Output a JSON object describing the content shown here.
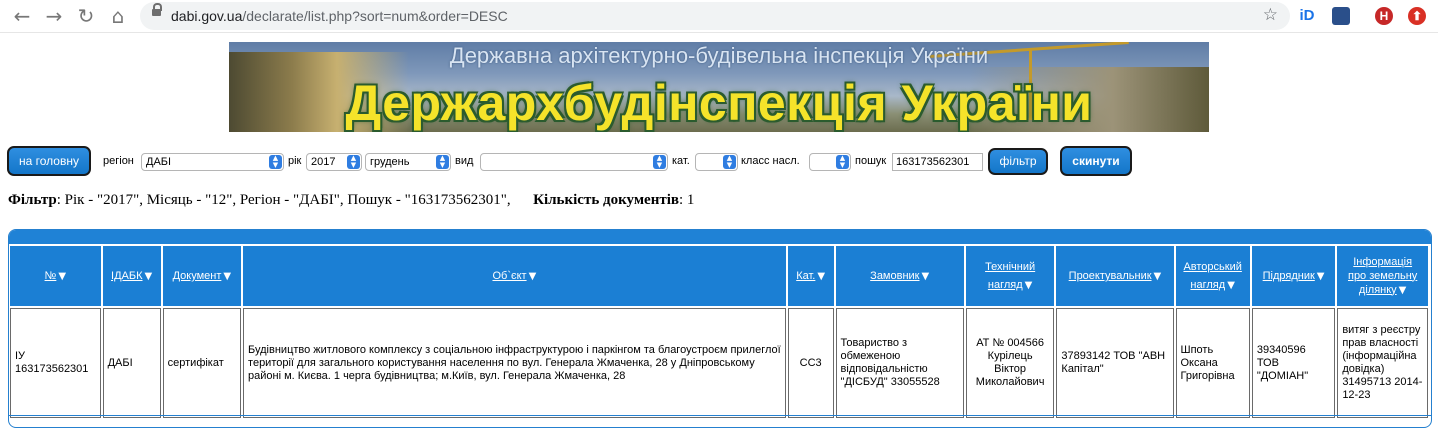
{
  "browser": {
    "url_domain": "dabi.gov.ua",
    "url_path": "/declarate/list.php?sort=num&order=DESC",
    "ext_id_label": "iD",
    "ext_h_label": "H"
  },
  "banner": {
    "subtitle": "Державна архітектурно-будівельна інспекція України",
    "title": "Держархбудінспекція України"
  },
  "toolbar": {
    "home_label": "на головну",
    "region_label": "регіон",
    "region_value": "ДАБІ",
    "year_label": "рік",
    "year_value": "2017",
    "month_value": "грудень",
    "type_label": "вид",
    "type_value": "",
    "cat_label": "кат.",
    "cat_value": "",
    "class_label": "класс насл.",
    "class_value": "",
    "search_label": "пошук",
    "search_value": "163173562301",
    "filter_label": "фільтр",
    "reset_label": "скинути"
  },
  "filter_info": {
    "filter_bold": "Фільтр",
    "filter_text": ": Рік - \"2017\", Місяць - \"12\", Регіон - \"ДАБІ\", Пошук - \"163173562301\",",
    "count_bold": "Кількість документів",
    "count_text": ": 1"
  },
  "table": {
    "headers": {
      "num": "№",
      "idabk": "ІДАБК",
      "doc": "Документ",
      "object": "Об`єкт",
      "cat": "Кат.",
      "customer": "Замовник",
      "tech_1": "Технічний",
      "tech_2": "нагляд",
      "designer": "Проектувальник",
      "author_1": "Авторський",
      "author_2": "нагляд",
      "contractor": "Підрядник",
      "land_1": "Інформація",
      "land_2": "про земельну",
      "land_3": "ділянку"
    },
    "row": {
      "num_1": "ІУ",
      "num_2": "163173562301",
      "idabk": "ДАБІ",
      "doc": "сертифікат",
      "object": "Будівництво житлового комплексу з соціальною інфраструктурою і паркінгом та благоустроєм прилеглої території для загального користування населення по вул. Генерала Жмаченка, 28 у Дніпровському районі м. Києва. 1 черга будівництва; м.Київ, вул. Генерала Жмаченка, 28",
      "cat": "СС3",
      "customer": "Товариство з обмеженою відповідальністю \"ДІСБУД\" 33055528",
      "tech": "АТ № 004566 Курілець Віктор Миколайович",
      "designer": "37893142 ТОВ \"АВН Капітал\"",
      "author": "Шпоть Оксана Григорівна",
      "contractor": "39340596 ТОВ \"ДОМІАН\"",
      "land": "витяг з реєстру прав власності (інформаційна довідка) 31495713 2014-12-23"
    }
  }
}
